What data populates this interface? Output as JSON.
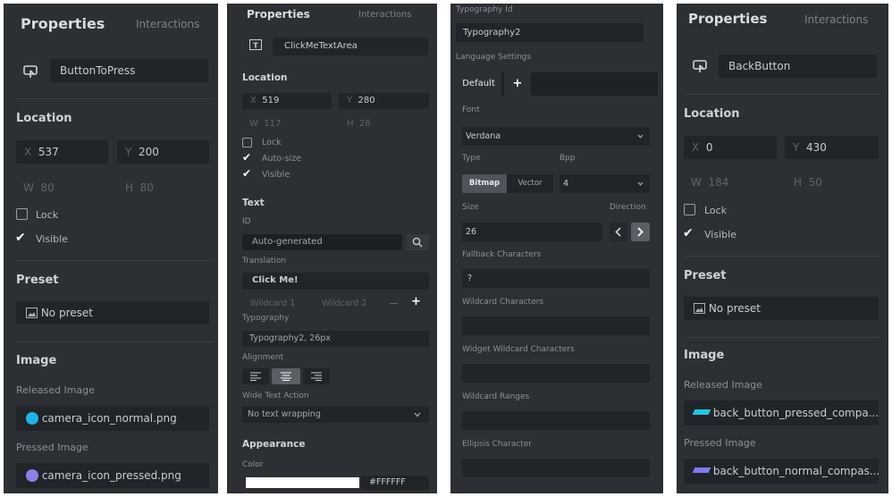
{
  "panel1": {
    "tab_properties": "Properties",
    "tab_interactions": "Interactions",
    "widget_name": "ButtonToPress",
    "location_title": "Location",
    "x_label": "X",
    "x_value": "537",
    "y_label": "Y",
    "y_value": "200",
    "w_label": "W",
    "w_value": "80",
    "h_label": "H",
    "h_value": "80",
    "lock_label": "Lock",
    "visible_label": "Visible",
    "preset_title": "Preset",
    "preset_value": "No preset",
    "image_title": "Image",
    "released_label": "Released Image",
    "released_value": "camera_icon_normal.png",
    "pressed_label": "Pressed Image",
    "pressed_value": "camera_icon_pressed.png"
  },
  "panel2": {
    "tab_properties": "Properties",
    "tab_interactions": "Interactions",
    "widget_name": "ClickMeTextArea",
    "location_title": "Location",
    "x_label": "X",
    "x_value": "519",
    "y_label": "Y",
    "y_value": "280",
    "w_label": "W",
    "w_value": "117",
    "h_label": "H",
    "h_value": "26",
    "lock_label": "Lock",
    "autosize_label": "Auto-size",
    "visible_label": "Visible",
    "text_title": "Text",
    "id_label": "ID",
    "id_value": "Auto-generated",
    "translation_label": "Translation",
    "translation_value": "Click Me!",
    "wildcard1": "Wildcard 1",
    "wildcard2": "Wildcard 2",
    "typography_label": "Typography",
    "typography_value": "Typography2, 26px",
    "alignment_label": "Alignment",
    "wide_label": "Wide Text Action",
    "wide_value": "No text wrapping",
    "appearance_title": "Appearance",
    "color_label": "Color",
    "color_value": "#FFFFFF"
  },
  "panel3": {
    "typography_id_label": "Typography Id",
    "typography_id_value": "Typography2",
    "language_label": "Language Settings",
    "tab_default": "Default",
    "tab_add": "+",
    "font_label": "Font",
    "font_value": "Verdana",
    "type_label": "Type",
    "bpp_label": "Bpp",
    "bitmap_label": "Bitmap",
    "vector_label": "Vector",
    "bpp_value": "4",
    "size_label": "Size",
    "size_value": "26",
    "direction_label": "Direction",
    "fallback_label": "Fallback Characters",
    "fallback_value": "?",
    "wildcard_chars_label": "Wildcard Characters",
    "widget_wildcard_label": "Widget Wildcard Characters",
    "wildcard_ranges_label": "Wildcard Ranges",
    "ellipsis_label": "Ellipsis Character"
  },
  "panel4": {
    "tab_properties": "Properties",
    "tab_interactions": "Interactions",
    "widget_name": "BackButton",
    "location_title": "Location",
    "x_label": "X",
    "x_value": "0",
    "y_label": "Y",
    "y_value": "430",
    "w_label": "W",
    "w_value": "184",
    "h_label": "H",
    "h_value": "50",
    "lock_label": "Lock",
    "visible_label": "Visible",
    "preset_title": "Preset",
    "preset_value": "No preset",
    "image_title": "Image",
    "released_label": "Released Image",
    "released_value": "back_button_pressed_compa...",
    "pressed_label": "Pressed Image",
    "pressed_value": "back_button_normal_compas..."
  },
  "colors": {
    "panel_bg": "#2c2f33",
    "field_bg": "#212428",
    "released_icon": "#1fb4e6",
    "pressed_icon": "#8e7ee8",
    "back_icon_released": "#1ec9e0",
    "back_icon_pressed": "#7d7cf0"
  }
}
